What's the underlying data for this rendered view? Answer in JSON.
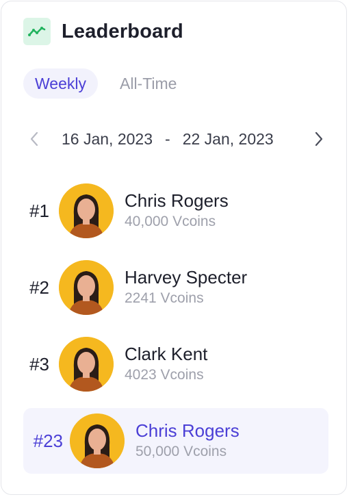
{
  "header": {
    "title": "Leaderboard",
    "icon": "trend-line-icon"
  },
  "tabs": [
    {
      "label": "Weekly",
      "active": true
    },
    {
      "label": "All-Time",
      "active": false
    }
  ],
  "date_range": {
    "from": "16 Jan, 2023",
    "separator": "-",
    "to": "22 Jan, 2023"
  },
  "leaders": [
    {
      "rank": "#1",
      "name": "Chris Rogers",
      "coins": "40,000 Vcoins"
    },
    {
      "rank": "#2",
      "name": "Harvey Specter",
      "coins": "2241 Vcoins"
    },
    {
      "rank": "#3",
      "name": "Clark Kent",
      "coins": "4023 Vcoins"
    }
  ],
  "current_user": {
    "rank": "#23",
    "name": "Chris Rogers",
    "coins": "50,000 Vcoins"
  },
  "colors": {
    "accent": "#4b3fd6",
    "icon_bg": "#dcf5e7",
    "icon_line": "#22b35e",
    "avatar_bg": "#f5b81f"
  }
}
